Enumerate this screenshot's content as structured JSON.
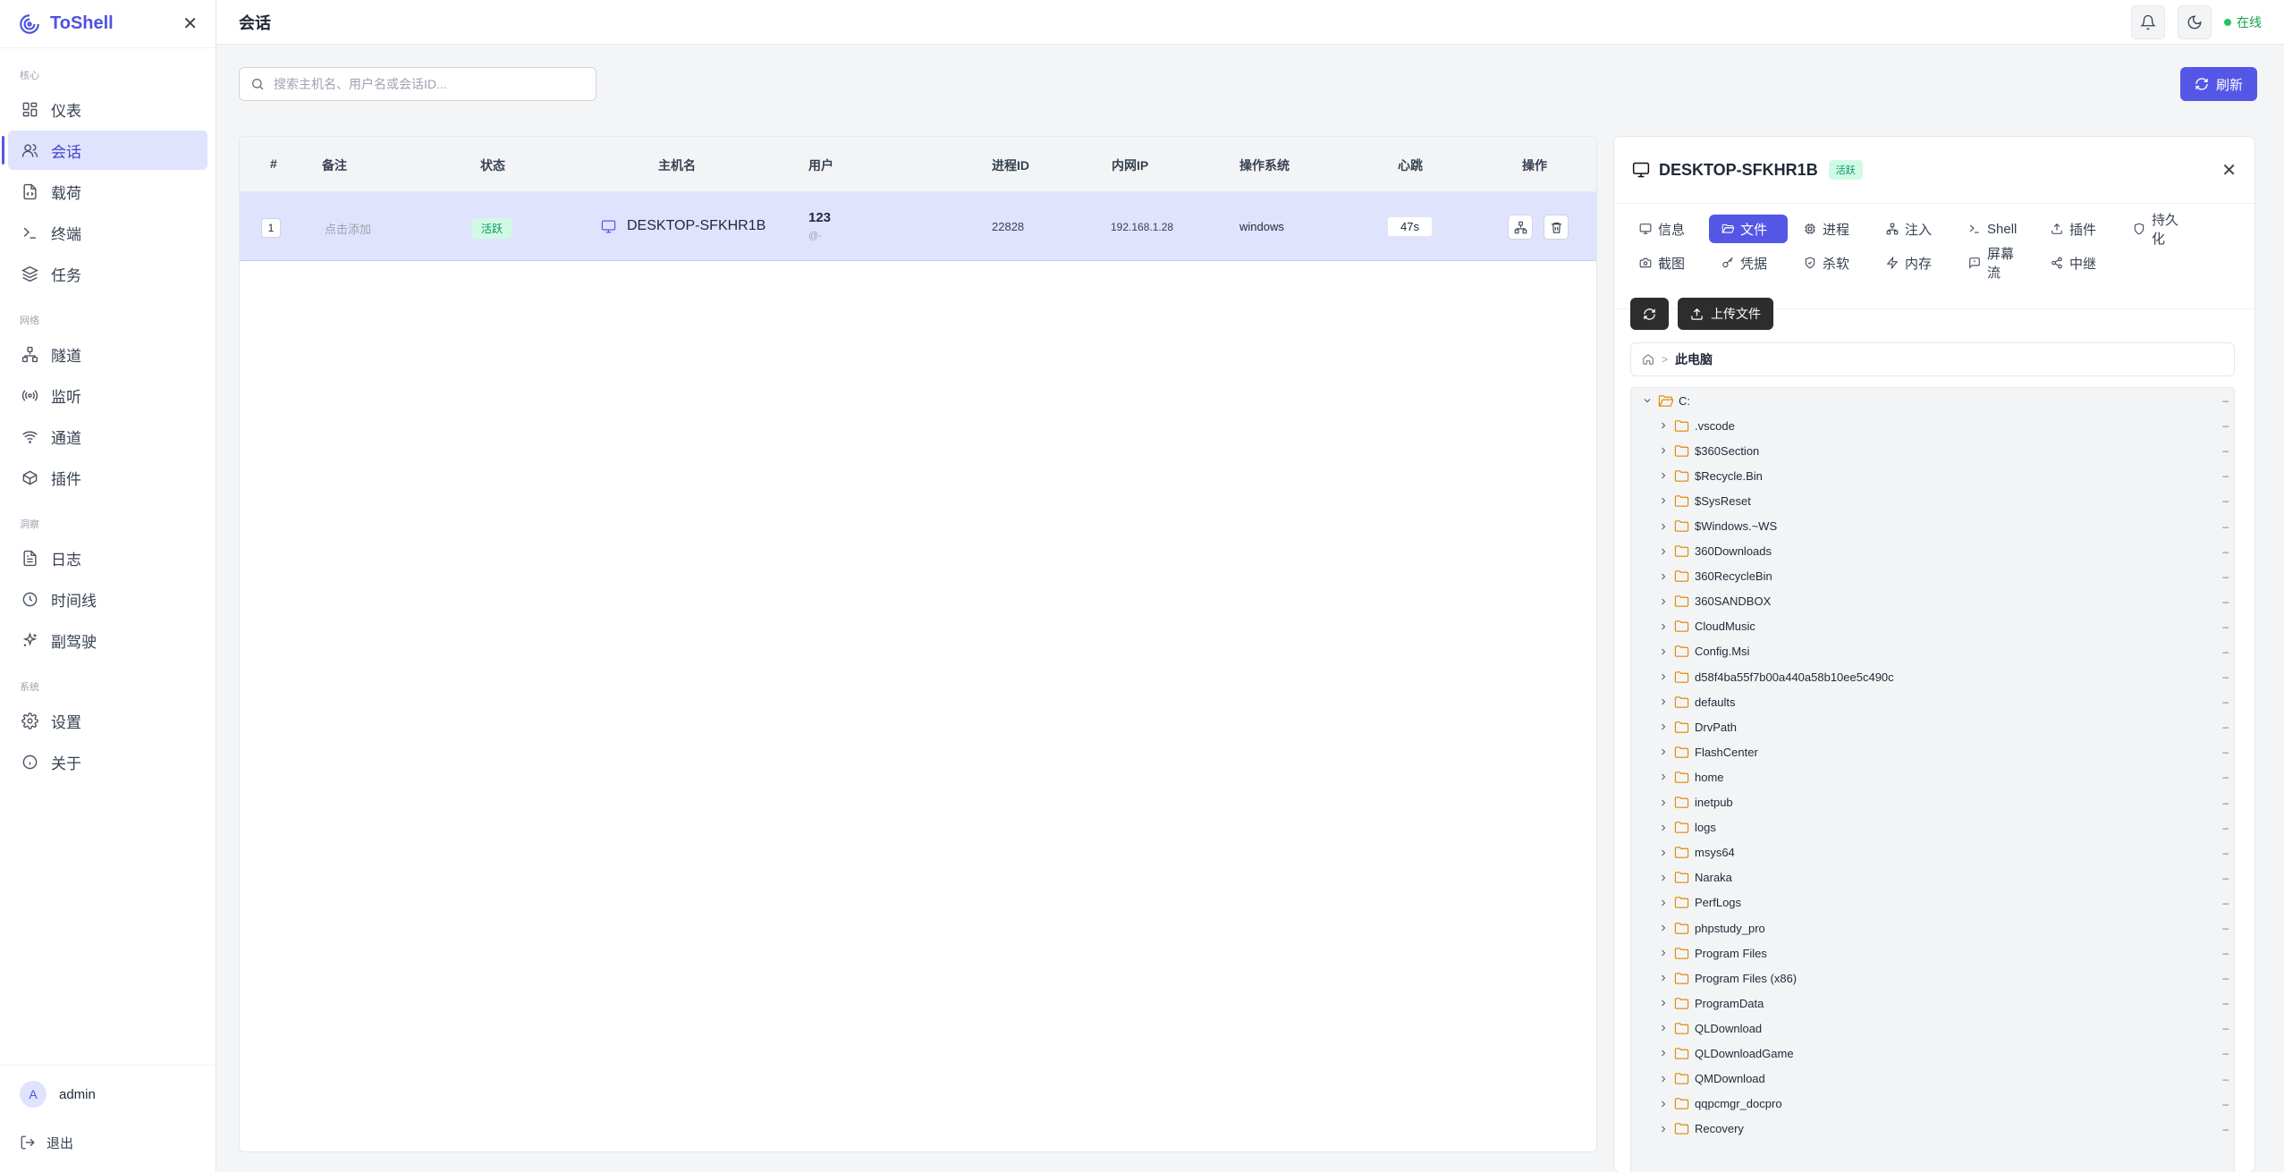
{
  "app": {
    "name": "ToShell",
    "page_title": "会话",
    "online": "在线"
  },
  "sidebar": {
    "sections": [
      {
        "label": "核心",
        "items": [
          {
            "label": "仪表",
            "icon": "dashboard-icon"
          },
          {
            "label": "会话",
            "icon": "users-icon",
            "active": true
          },
          {
            "label": "载荷",
            "icon": "file-code-icon"
          },
          {
            "label": "终端",
            "icon": "terminal-icon"
          },
          {
            "label": "任务",
            "icon": "layers-icon"
          }
        ]
      },
      {
        "label": "网络",
        "items": [
          {
            "label": "隧道",
            "icon": "network-icon"
          },
          {
            "label": "监听",
            "icon": "radio-icon"
          },
          {
            "label": "通道",
            "icon": "wifi-icon"
          },
          {
            "label": "插件",
            "icon": "package-icon"
          }
        ]
      },
      {
        "label": "洞察",
        "items": [
          {
            "label": "日志",
            "icon": "log-icon"
          },
          {
            "label": "时间线",
            "icon": "clock-icon"
          },
          {
            "label": "副驾驶",
            "icon": "sparkles-icon"
          }
        ]
      },
      {
        "label": "系统",
        "items": [
          {
            "label": "设置",
            "icon": "gear-icon"
          },
          {
            "label": "关于",
            "icon": "info-icon"
          }
        ]
      }
    ],
    "user": {
      "initial": "A",
      "name": "admin"
    },
    "logout": "退出"
  },
  "search": {
    "placeholder": "搜索主机名、用户名或会话ID..."
  },
  "refresh_label": "刷新",
  "table": {
    "headers": [
      "#",
      "备注",
      "状态",
      "主机名",
      "用户",
      "进程ID",
      "内网IP",
      "操作系统",
      "心跳",
      "操作"
    ],
    "rows": [
      {
        "index": "1",
        "remark": "点击添加",
        "status": "活跃",
        "hostname": "DESKTOP-SFKHR1B",
        "user": "123",
        "user_sub": "@-",
        "pid": "22828",
        "ip": "192.168.1.28",
        "os": "windows",
        "heartbeat": "47s"
      }
    ]
  },
  "panel": {
    "title": "DESKTOP-SFKHR1B",
    "status": "活跃",
    "tabs": [
      {
        "label": "信息",
        "icon": "info-box-icon"
      },
      {
        "label": "文件",
        "icon": "folder-open-icon",
        "active": true
      },
      {
        "label": "进程",
        "icon": "cpu-icon"
      },
      {
        "label": "注入",
        "icon": "inject-icon"
      },
      {
        "label": "Shell",
        "icon": "terminal-icon"
      },
      {
        "label": "插件",
        "icon": "upload-icon"
      },
      {
        "label": "持久化",
        "icon": "shield-icon"
      },
      {
        "label": "截图",
        "icon": "camera-icon"
      },
      {
        "label": "凭据",
        "icon": "key-icon"
      },
      {
        "label": "杀软",
        "icon": "shield-check-icon"
      },
      {
        "label": "内存",
        "icon": "bolt-icon"
      },
      {
        "label": "屏幕流",
        "icon": "screen-stream-icon"
      },
      {
        "label": "中继",
        "icon": "share-icon"
      }
    ],
    "upload_label": "上传文件",
    "breadcrumb_current": "此电脑",
    "tree_root": "C:",
    "tree_dash": "–",
    "folders": [
      ".vscode",
      "$360Section",
      "$Recycle.Bin",
      "$SysReset",
      "$Windows.~WS",
      "360Downloads",
      "360RecycleBin",
      "360SANDBOX",
      "CloudMusic",
      "Config.Msi",
      "d58f4ba55f7b00a440a58b10ee5c490c",
      "defaults",
      "DrvPath",
      "FlashCenter",
      "home",
      "inetpub",
      "logs",
      "msys64",
      "Naraka",
      "PerfLogs",
      "phpstudy_pro",
      "Program Files",
      "Program Files (x86)",
      "ProgramData",
      "QLDownload",
      "QLDownloadGame",
      "QMDownload",
      "qqpcmgr_docpro",
      "Recovery"
    ]
  },
  "colors": {
    "accent": "#5457e6",
    "active_bg": "#e0e3fd",
    "success": "#059669",
    "folder": "#e08a00"
  }
}
